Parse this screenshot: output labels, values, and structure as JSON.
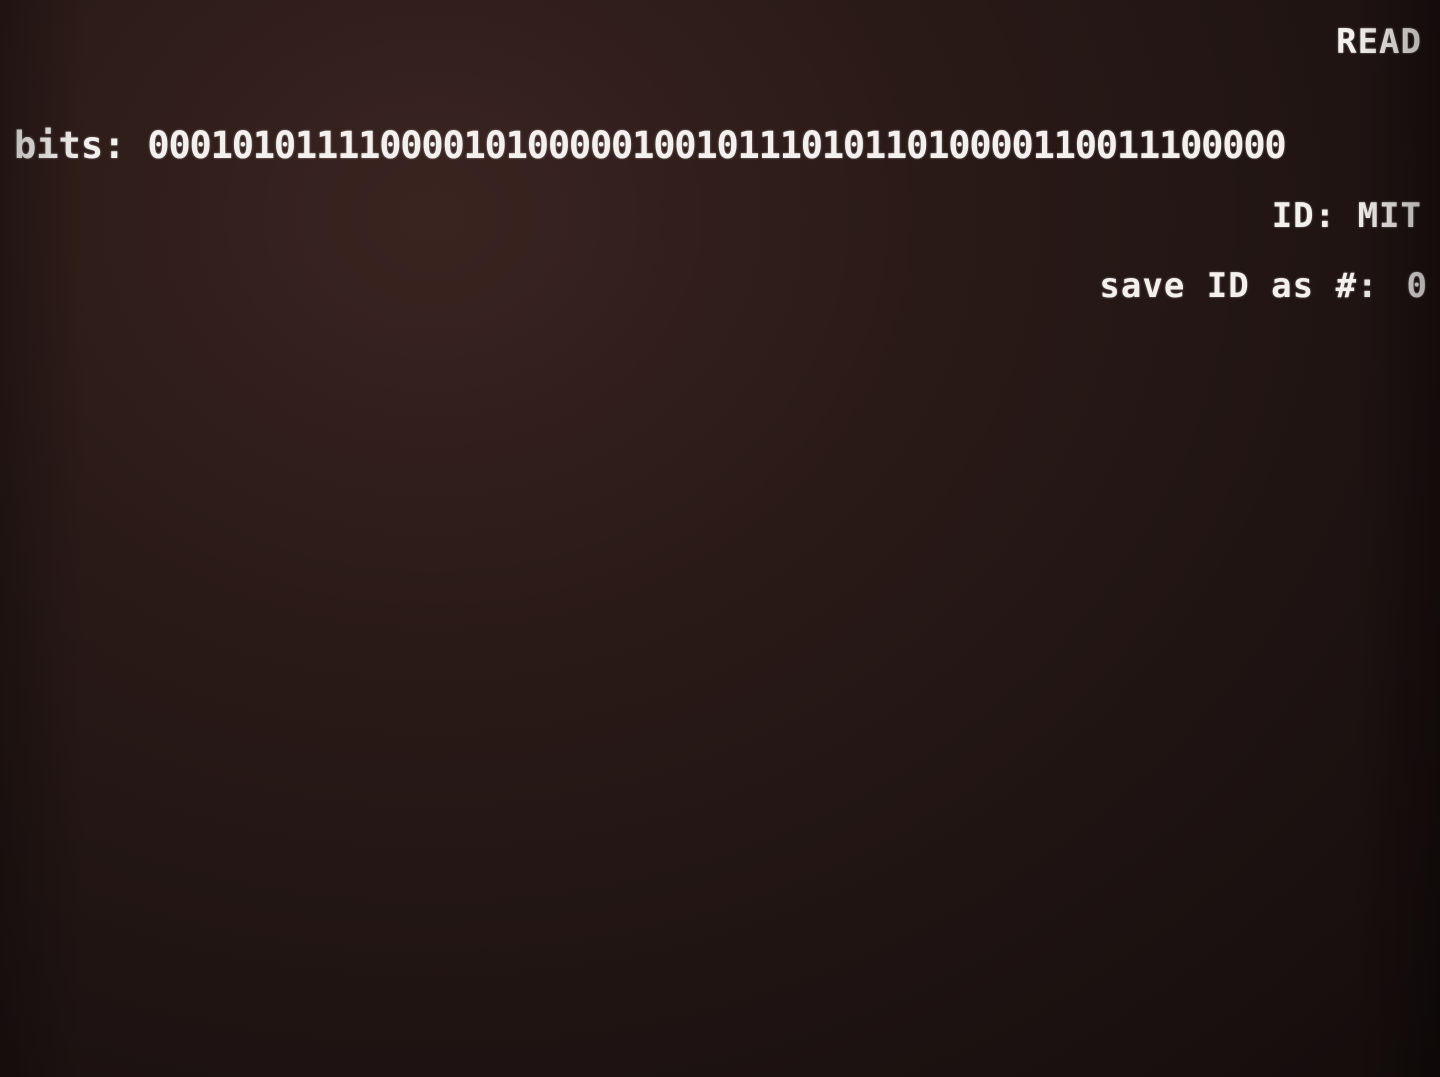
{
  "status": {
    "text": "READ"
  },
  "bits": {
    "label": "bits:",
    "value": "000101011110000101000001001011101011010000110011100000"
  },
  "id": {
    "label": "ID: MIT"
  },
  "save": {
    "label": "save ID as #:",
    "value": "0"
  },
  "colors": {
    "background": "#241614",
    "text": "#f4f0ee"
  }
}
